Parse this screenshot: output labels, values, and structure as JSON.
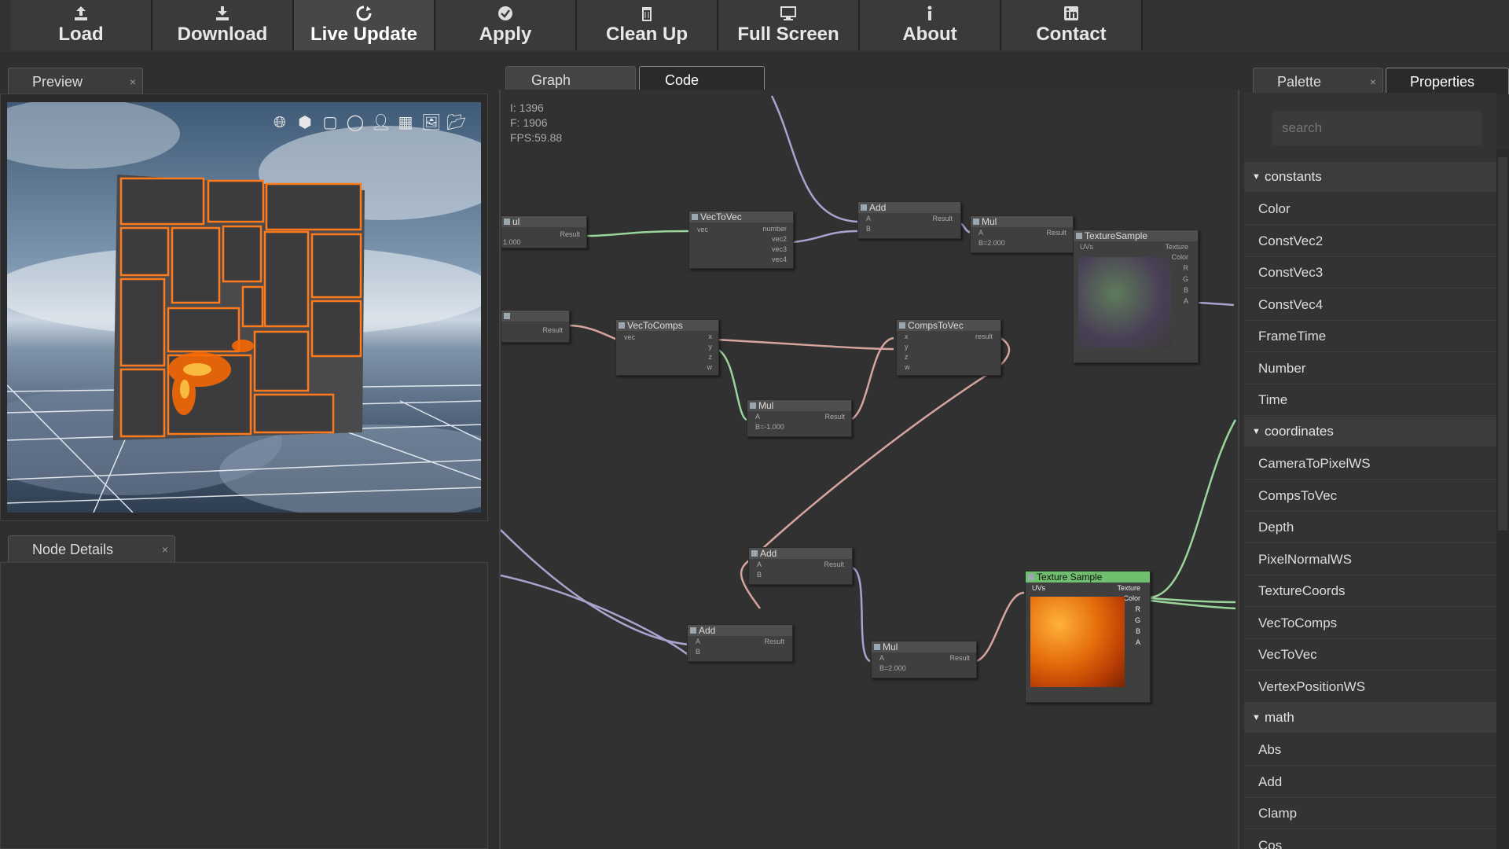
{
  "toolbar": {
    "buttons": [
      {
        "label": "Load",
        "icon": "upload-icon"
      },
      {
        "label": "Download",
        "icon": "download-icon"
      },
      {
        "label": "Live Update",
        "icon": "refresh-icon",
        "active": true
      },
      {
        "label": "Apply",
        "icon": "check-circle-icon"
      },
      {
        "label": "Clean Up",
        "icon": "trash-icon"
      },
      {
        "label": "Full Screen",
        "icon": "monitor-icon"
      },
      {
        "label": "About",
        "icon": "info-icon"
      },
      {
        "label": "Contact",
        "icon": "linkedin-icon"
      }
    ]
  },
  "preview": {
    "tab_label": "Preview",
    "close": "×",
    "tools": [
      "globe-icon",
      "cube-icon",
      "square-icon",
      "circle-icon",
      "person-icon",
      "grid-icon",
      "image-icon",
      "folder-icon"
    ]
  },
  "node_details": {
    "tab_label": "Node Details",
    "close": "×"
  },
  "graph": {
    "tabs": [
      "Graph",
      "Code"
    ],
    "active_tab": "Graph",
    "stats": [
      "I: 1396",
      "F: 1906",
      "FPS:59.88"
    ],
    "nodes": {
      "vectovec": {
        "title": "VecToVec",
        "in": "vec",
        "outs": [
          "number",
          "vec2",
          "vec3",
          "vec4"
        ]
      },
      "add1": {
        "title": "Add",
        "a": "A",
        "b": "B",
        "result": "Result"
      },
      "mul1": {
        "title": "Mul",
        "a": "A",
        "result": "Result",
        "b": "B=2.000"
      },
      "tex1": {
        "title": "TextureSample",
        "in": "UVs",
        "outs": [
          "Texture",
          "Color",
          "R",
          "G",
          "B",
          "A"
        ]
      },
      "left1": {
        "title": "ul",
        "result": "Result",
        "val": "1.000"
      },
      "left2": {
        "result": "Result"
      },
      "vectocomps": {
        "title": "VecToComps",
        "in": "vec",
        "outs": [
          "x",
          "y",
          "z",
          "w"
        ]
      },
      "compstovec": {
        "title": "CompsToVec",
        "ins": [
          "x",
          "y",
          "z",
          "w"
        ],
        "result": "result"
      },
      "mul2": {
        "title": "Mul",
        "a": "A",
        "result": "Result",
        "b": "B=-1.000"
      },
      "add2": {
        "title": "Add",
        "a": "A",
        "b": "B",
        "result": "Result"
      },
      "add3": {
        "title": "Add",
        "a": "A",
        "b": "B",
        "result": "Result"
      },
      "mul3": {
        "title": "Mul",
        "a": "A",
        "result": "Result",
        "b": "B=2.000"
      },
      "tex2": {
        "title": "Texture Sample",
        "in": "UVs",
        "outs": [
          "Texture",
          "Color",
          "R",
          "G",
          "B",
          "A"
        ]
      }
    }
  },
  "palette": {
    "tabs": [
      {
        "label": "Palette",
        "close": "×"
      },
      {
        "label": "Properties"
      }
    ],
    "search_placeholder": "search",
    "categories": [
      {
        "name": "constants",
        "items": [
          "Color",
          "ConstVec2",
          "ConstVec3",
          "ConstVec4",
          "FrameTime",
          "Number",
          "Time"
        ]
      },
      {
        "name": "coordinates",
        "items": [
          "CameraToPixelWS",
          "CompsToVec",
          "Depth",
          "PixelNormalWS",
          "TextureCoords",
          "VecToComps",
          "VecToVec",
          "VertexPositionWS"
        ]
      },
      {
        "name": "math",
        "items": [
          "Abs",
          "Add",
          "Clamp",
          "Cos"
        ]
      }
    ]
  },
  "colors": {
    "accent_green": "#6fbf6f",
    "wire_purple": "#a9a3cf",
    "wire_pink": "#d6a5a0",
    "wire_green": "#9bd49b"
  }
}
